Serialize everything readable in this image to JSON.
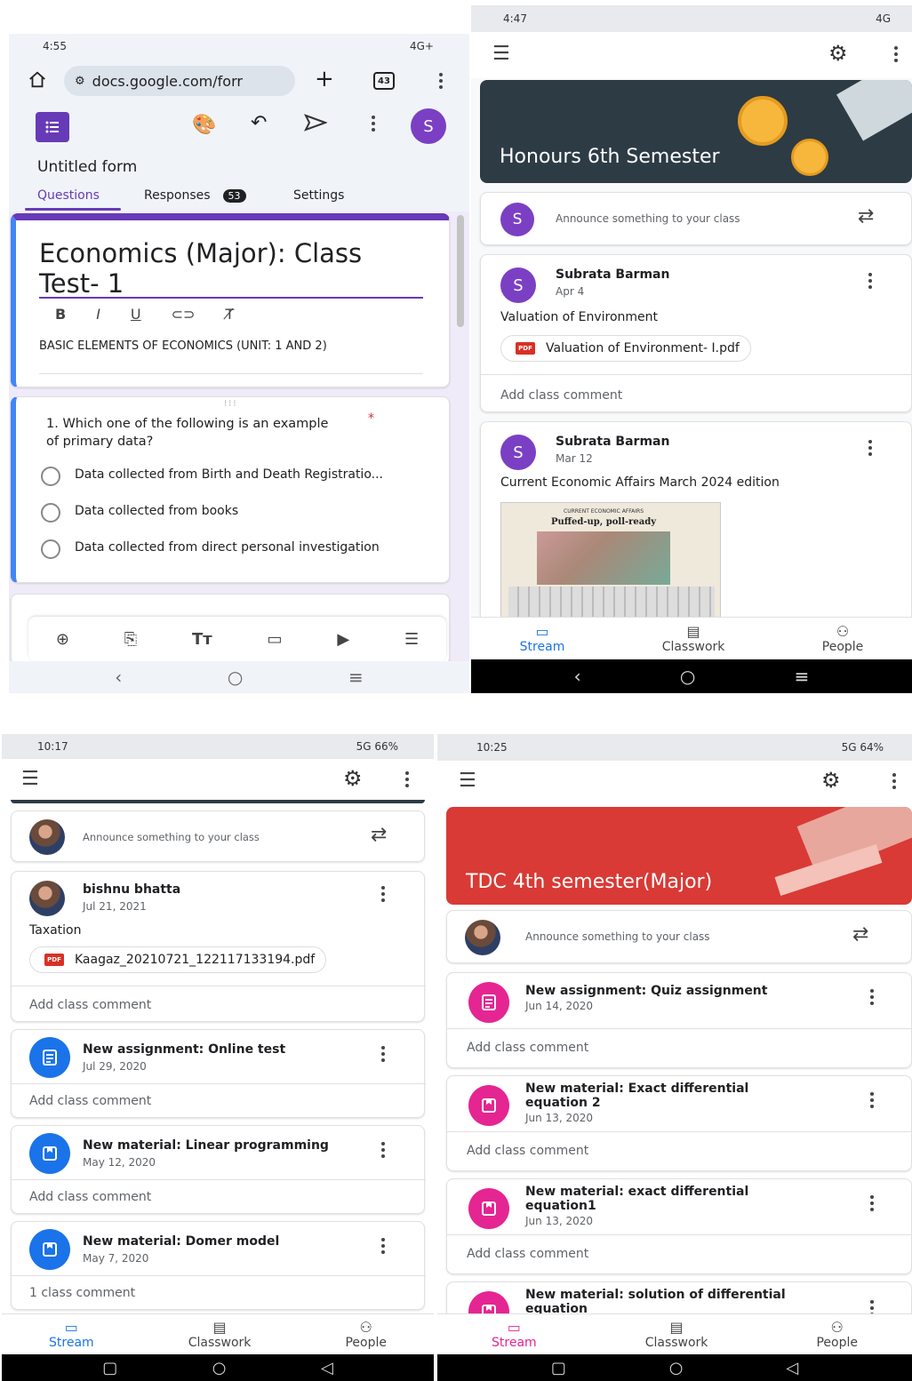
{
  "q1": {
    "status_time": "4:55",
    "status_right": "4G+",
    "url": "docs.google.com/forr",
    "tab_count": "43",
    "avatar_letter": "S",
    "form_name": "Untitled form",
    "tabs": {
      "questions": "Questions",
      "responses": "Responses",
      "responses_count": "53",
      "settings": "Settings"
    },
    "title": "Economics (Major): Class Test- 1",
    "description": "BASIC ELEMENTS OF ECONOMICS (UNIT: 1 AND 2)",
    "question": "1. Which one of the following is an example of primary data?",
    "required_mark": "*",
    "options": [
      "Data collected from Birth and Death Registratio...",
      "Data collected from books",
      "Data collected from direct personal investigation"
    ]
  },
  "q2": {
    "status_time": "4:47",
    "status_right": "4G",
    "banner_title": "Honours 6th Semester",
    "announce": "Announce something to your class",
    "posts": [
      {
        "avatar": "S",
        "name": "Subrata Barman",
        "date": "Apr 4",
        "text": "Valuation of Environment",
        "file": "Valuation of Environment- I.pdf",
        "comment": "Add class comment"
      },
      {
        "avatar": "S",
        "name": "Subrata Barman",
        "date": "Mar 12",
        "text": "Current Economic Affairs March 2024 edition",
        "thumb_caption": "CURRENT ECONOMIC AFFAIRS",
        "thumb_headline": "Puffed-up, poll-ready"
      }
    ],
    "nav": {
      "stream": "Stream",
      "classwork": "Classwork",
      "people": "People"
    }
  },
  "q3": {
    "status_time": "10:17",
    "status_right": "5G",
    "battery": "66%",
    "announce": "Announce something to your class",
    "post": {
      "name": "bishnu bhatta",
      "date": "Jul 21, 2021",
      "text": "Taxation",
      "file": "Kaagaz_20210721_122117133194.pdf",
      "comment": "Add class comment"
    },
    "items": [
      {
        "title": "New assignment: Online test",
        "date": "Jul 29, 2020",
        "comment": "Add class comment"
      },
      {
        "title": "New material: Linear programming",
        "date": "May 12, 2020",
        "comment": "Add class comment"
      },
      {
        "title": "New material: Domer model",
        "date": "May 7, 2020",
        "comment": "1 class comment"
      }
    ],
    "nav": {
      "stream": "Stream",
      "classwork": "Classwork",
      "people": "People"
    }
  },
  "q4": {
    "status_time": "10:25",
    "status_right": "5G",
    "battery": "64%",
    "banner_title": "TDC 4th semester(Major)",
    "announce": "Announce something to your class",
    "items": [
      {
        "title": "New assignment: Quiz assignment",
        "date": "Jun 14, 2020",
        "comment": "Add class comment"
      },
      {
        "title": "New material: Exact differential equation 2",
        "date": "Jun 13, 2020",
        "comment": "Add class comment"
      },
      {
        "title": "New material: exact differential equation1",
        "date": "Jun 13, 2020",
        "comment": "Add class comment"
      },
      {
        "title": "New material: solution of differential equation"
      }
    ],
    "nav": {
      "stream": "Stream",
      "classwork": "Classwork",
      "people": "People"
    }
  },
  "colors": {
    "google_purple": "#673ab7",
    "classroom_blue": "#1a73e8",
    "pink": "#e52592",
    "banner_dark": "#2d3b45",
    "banner_red": "#d93a35"
  }
}
